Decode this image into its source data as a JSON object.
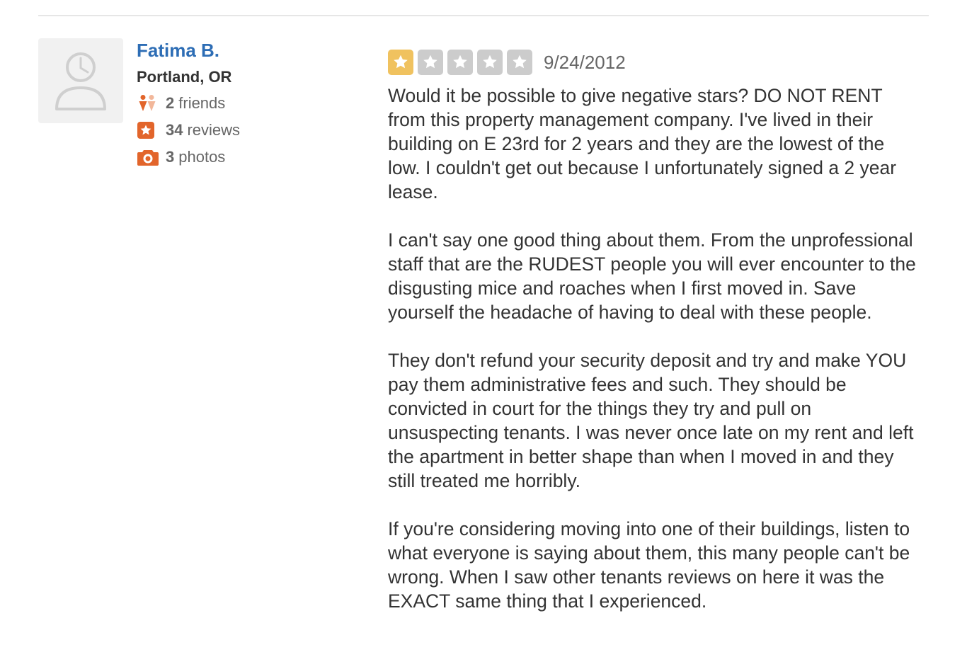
{
  "user": {
    "name": "Fatima B.",
    "location": "Portland, OR",
    "friends_count": "2",
    "friends_label": "friends",
    "reviews_count": "34",
    "reviews_label": "reviews",
    "photos_count": "3",
    "photos_label": "photos"
  },
  "review": {
    "rating": 1,
    "max_rating": 5,
    "date": "9/24/2012",
    "paragraphs": [
      "Would it be possible to give negative stars? DO NOT RENT from this property management company. I've lived in their building on E 23rd for 2 years and they are the lowest of the low. I couldn't get out because I unfortunately signed a 2 year lease.",
      "I can't say one good thing about them. From the unprofessional staff that are the RUDEST people you will ever encounter to the disgusting mice and roaches when I first moved in. Save yourself the headache of having to deal with these people.",
      "They don't refund your security deposit and try and make YOU pay them administrative fees and such. They should be convicted in court for the things they try and pull on unsuspecting tenants. I was never once late on my rent and left the apartment in better shape than when I moved in and they still treated me horribly.",
      "If you're considering moving into one of their buildings, listen to what everyone is saying about them, this many people can't be wrong. When I saw other tenants reviews on here it was the EXACT same thing that I experienced."
    ]
  },
  "colors": {
    "name_link": "#2d6db5",
    "star_filled": "#f0c25f",
    "star_empty": "#cccccc",
    "stat_icon": "#e2652b"
  },
  "icons": [
    "default-avatar-icon",
    "friends-icon",
    "review-star-icon",
    "camera-icon",
    "rating-star-icon"
  ]
}
